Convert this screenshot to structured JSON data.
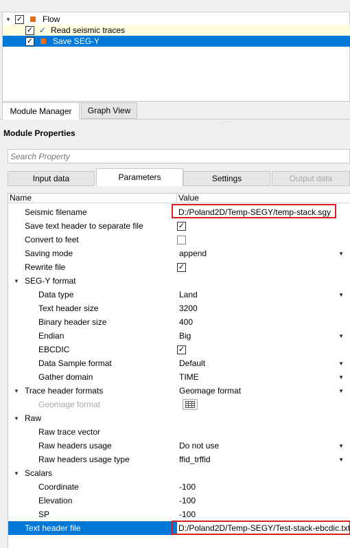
{
  "flow": {
    "root_label": "Flow",
    "items": [
      {
        "label": "Read seismic traces"
      },
      {
        "label": "Save SEG-Y"
      }
    ],
    "colors": {
      "root_square": "#e07020",
      "item_square": "#e07020",
      "tick": "#1a55b8"
    }
  },
  "view_tabs": {
    "module_manager": "Module Manager",
    "graph_view": "Graph View"
  },
  "module_properties": {
    "title": "Module Properties",
    "search_placeholder": "Search Property",
    "tabs": {
      "input_data": "Input data",
      "parameters": "Parameters",
      "settings": "Settings",
      "output_data": "Output data"
    }
  },
  "grid": {
    "header": {
      "name": "Name",
      "value": "Value"
    },
    "rows": {
      "seismic_filename": {
        "name": "Seismic filename",
        "value": "D:/Poland2D/Temp-SEGY/temp-stack.sgy"
      },
      "save_text_header": {
        "name": "Save text header to separate file",
        "checked": true
      },
      "convert_to_feet": {
        "name": "Convert to feet",
        "checked": false
      },
      "saving_mode": {
        "name": "Saving mode",
        "value": "append"
      },
      "rewrite_file": {
        "name": "Rewrite file",
        "checked": true
      },
      "segy_format": {
        "name": "SEG-Y format"
      },
      "data_type": {
        "name": "Data type",
        "value": "Land"
      },
      "text_header_size": {
        "name": "Text header size",
        "value": "3200"
      },
      "binary_header_size": {
        "name": "Binary header size",
        "value": "400"
      },
      "endian": {
        "name": "Endian",
        "value": "Big"
      },
      "ebcdic": {
        "name": "EBCDIC",
        "checked": true
      },
      "data_sample_format": {
        "name": "Data Sample format",
        "value": "Default"
      },
      "gather_domain": {
        "name": "Gather domain",
        "value": "TIME"
      },
      "trace_header_formats": {
        "name": "Trace header formats",
        "value": "Geomage format"
      },
      "geomage_format": {
        "name": "Geomage format"
      },
      "raw": {
        "name": "Raw"
      },
      "raw_trace_vector": {
        "name": "Raw trace vector"
      },
      "raw_headers_usage": {
        "name": "Raw headers usage",
        "value": "Do not use"
      },
      "raw_headers_usage_type": {
        "name": "Raw headers usage type",
        "value": "ffid_trffid"
      },
      "scalars": {
        "name": "Scalars"
      },
      "coordinate": {
        "name": "Coordinate",
        "value": "-100"
      },
      "elevation": {
        "name": "Elevation",
        "value": "-100"
      },
      "sp": {
        "name": "SP",
        "value": "-100"
      },
      "text_header_file": {
        "name": "Text header file",
        "value": "D:/Poland2D/Temp-SEGY/Test-stack-ebcdic.txt"
      }
    }
  },
  "colors": {
    "selection": "#0078d7",
    "highlight_box": "#d61e1e"
  }
}
